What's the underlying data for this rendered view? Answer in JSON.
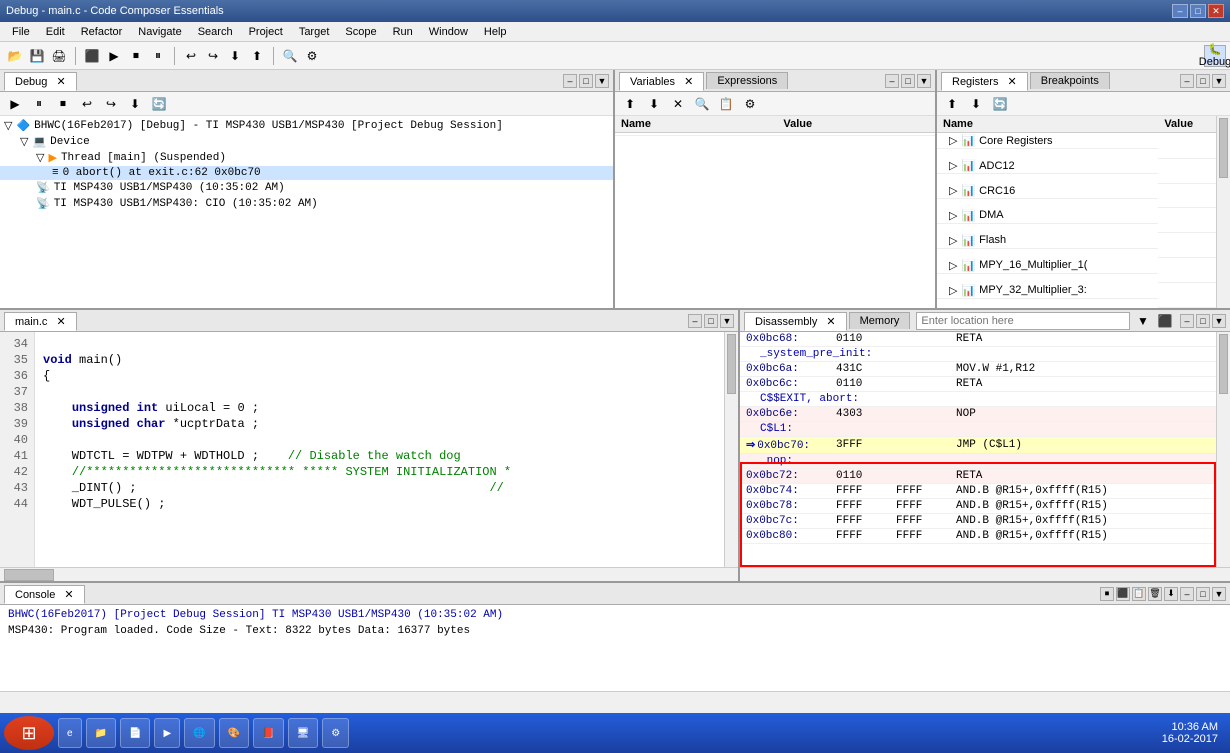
{
  "titleBar": {
    "title": "Debug - main.c - Code Composer Essentials",
    "minBtn": "–",
    "maxBtn": "□",
    "closeBtn": "✕"
  },
  "menuBar": {
    "items": [
      "File",
      "Edit",
      "Refactor",
      "Navigate",
      "Search",
      "Project",
      "Target",
      "Scope",
      "Run",
      "Window",
      "Help"
    ]
  },
  "debugPanel": {
    "tabLabel": "Debug",
    "tabClose": "✕",
    "treeItems": [
      {
        "indent": 0,
        "icon": "🔷",
        "label": "BHWC(16Feb2017) [Debug] - TI MSP430 USB1/MSP430 [Project Debug Session]"
      },
      {
        "indent": 1,
        "icon": "💻",
        "label": "Device"
      },
      {
        "indent": 2,
        "icon": "▶",
        "label": "Thread [main] (Suspended)"
      },
      {
        "indent": 3,
        "icon": "=",
        "label": "0 abort() at exit.c:62 0x0bc70"
      },
      {
        "indent": 2,
        "icon": "📡",
        "label": "TI MSP430 USB1/MSP430 (10:35:02 AM)"
      },
      {
        "indent": 2,
        "icon": "📡",
        "label": "TI MSP430 USB1/MSP430: CIO (10:35:02 AM)"
      }
    ]
  },
  "variablesPanel": {
    "tabLabel": "Variables",
    "tabClose": "✕",
    "expressionsTab": "Expressions",
    "columns": [
      "Name",
      "Value"
    ]
  },
  "registersPanel": {
    "tabLabel": "Registers",
    "breakpointsTab": "Breakpoints",
    "tabClose": "✕",
    "columns": [
      "Name",
      "Value"
    ],
    "groups": [
      "Core Registers",
      "ADC12",
      "CRC16",
      "DMA",
      "Flash",
      "MPY_16_Multiplier_1(",
      "MPY_32_Multiplier_3:"
    ]
  },
  "codeEditor": {
    "tabLabel": "main.c",
    "tabClose": "✕",
    "lines": [
      {
        "num": "34",
        "code": ""
      },
      {
        "num": "35",
        "code": "void main()"
      },
      {
        "num": "36",
        "code": "{"
      },
      {
        "num": "37",
        "code": ""
      },
      {
        "num": "38",
        "code": "    unsigned int uiLocal = 0 ;"
      },
      {
        "num": "39",
        "code": "    unsigned char *ucptrData ;"
      },
      {
        "num": "40",
        "code": ""
      },
      {
        "num": "41",
        "code": "    WDTCTL = WDTPW + WDTHOLD ;    // Disable the watch dog"
      },
      {
        "num": "42",
        "code": "    //******************************* ***** SYSTEM INITIALIZATION *"
      },
      {
        "num": "43",
        "code": "    _DINT() ;                                                 //"
      },
      {
        "num": "44",
        "code": "    WDT_PULSE() ;"
      }
    ]
  },
  "disasmPanel": {
    "tabLabel": "Disassembly",
    "memoryTab": "Memory",
    "locationPlaceholder": "Enter location here",
    "rows": [
      {
        "addr": "0x0bc68:",
        "opcode": "0110",
        "mnemonic": "",
        "operand": "RETA",
        "highlight": ""
      },
      {
        "addr": "_system_pre_init:",
        "opcode": "",
        "mnemonic": "",
        "operand": "",
        "highlight": "label"
      },
      {
        "addr": "0x0bc6a:",
        "opcode": "431C",
        "mnemonic": "",
        "operand": "MOV.W   #1,R12",
        "highlight": ""
      },
      {
        "addr": "0x0bc6c:",
        "opcode": "0110",
        "mnemonic": "",
        "operand": "RETA",
        "highlight": ""
      },
      {
        "addr": "C$$EXIT, abort:",
        "opcode": "",
        "mnemonic": "",
        "operand": "",
        "highlight": "label"
      },
      {
        "addr": "0x0bc6e:",
        "opcode": "4303",
        "mnemonic": "",
        "operand": "NOP",
        "highlight": "red"
      },
      {
        "addr": "C$L1:",
        "opcode": "",
        "mnemonic": "",
        "operand": "",
        "highlight": "red-label"
      },
      {
        "addr": "0x0bc70:",
        "opcode": "3FFF",
        "mnemonic": "",
        "operand": "JMP    (C$L1)",
        "highlight": "red-arrow"
      },
      {
        "addr": "_nop:",
        "opcode": "",
        "mnemonic": "",
        "operand": "",
        "highlight": "red-label"
      },
      {
        "addr": "0x0bc72:",
        "opcode": "0110",
        "mnemonic": "",
        "operand": "RETA",
        "highlight": "red"
      },
      {
        "addr": "0x0bc74:",
        "opcode": "FFFF",
        "mnemonic": "FFFF",
        "operand": "AND.B   @R15+,0xffff(R15)",
        "highlight": ""
      },
      {
        "addr": "0x0bc78:",
        "opcode": "FFFF",
        "mnemonic": "FFFF",
        "operand": "AND.B   @R15+,0xffff(R15)",
        "highlight": ""
      },
      {
        "addr": "0x0bc7c:",
        "opcode": "FFFF",
        "mnemonic": "FFFF",
        "operand": "AND.B   @R15+,0xffff(R15)",
        "highlight": ""
      },
      {
        "addr": "0x0bc80:",
        "opcode": "FFFF",
        "mnemonic": "FFFF",
        "operand": "AND.B   @R15+,0xffff(R15)",
        "highlight": ""
      }
    ]
  },
  "consolePanel": {
    "tabLabel": "Console",
    "tabClose": "✕",
    "sessionLabel": "BHWC(16Feb2017) [Project Debug Session] TI MSP430 USB1/MSP430 (10:35:02 AM)",
    "content": "MSP430: Program loaded. Code Size - Text: 8322 bytes  Data: 16377 bytes"
  },
  "statusBar": {
    "leftStatus": "",
    "rightStatus": ""
  },
  "taskbar": {
    "time": "10:36 AM",
    "date": "16-02-2017",
    "startIcon": "⊞",
    "appButtons": [
      "IE",
      "Explorer",
      "Docs",
      "Media",
      "Chrome",
      "Paint",
      "PDF",
      "Network",
      "Settings"
    ]
  }
}
